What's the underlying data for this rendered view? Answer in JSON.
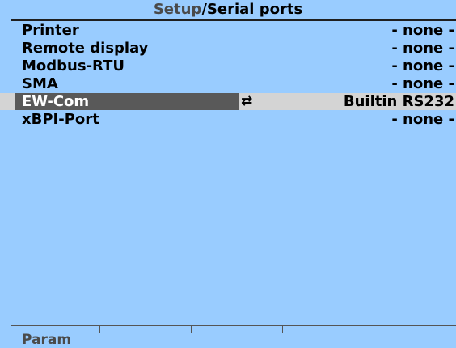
{
  "header": {
    "breadcrumb": "Setup",
    "separator": "/",
    "current": "Serial ports"
  },
  "rows": [
    {
      "label": "Printer",
      "value": "- none -"
    },
    {
      "label": "Remote display",
      "value": "- none -"
    },
    {
      "label": "Modbus-RTU",
      "value": "- none -"
    },
    {
      "label": "SMA",
      "value": "- none -"
    },
    {
      "label": "EW-Com",
      "value": "Builtin RS232",
      "icon": "swap-arrows-icon",
      "selected": true
    },
    {
      "label": "xBPI-Port",
      "value": "- none -"
    }
  ],
  "softkeys": {
    "key1": "Param"
  },
  "colors": {
    "background": "#99ccff",
    "selected_label_bg": "#595959",
    "selected_value_bg": "#d4d4d4"
  }
}
